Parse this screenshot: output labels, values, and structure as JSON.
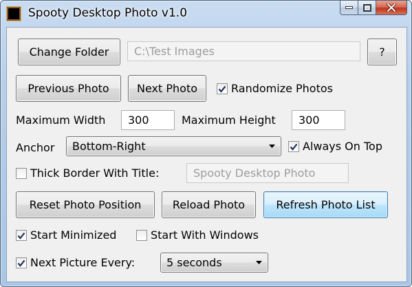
{
  "window": {
    "title": "Spooty Desktop Photo v1.0"
  },
  "icons": {
    "app": "app-photo-icon",
    "minimize": "minimize-icon",
    "maximize": "maximize-icon",
    "close": "close-icon",
    "checkmark": "checkmark-icon",
    "dropdown": "chevron-down-icon"
  },
  "folder": {
    "change_label": "Change Folder",
    "path_value": "C:\\Test Images",
    "help_label": "?"
  },
  "nav": {
    "previous_label": "Previous Photo",
    "next_label": "Next Photo",
    "randomize": {
      "label": "Randomize Photos",
      "checked": true
    }
  },
  "size": {
    "max_width_label": "Maximum Width",
    "max_width_value": "300",
    "max_height_label": "Maximum Height",
    "max_height_value": "300"
  },
  "anchor": {
    "label": "Anchor",
    "selected": "Bottom-Right",
    "always_on_top": {
      "label": "Always On Top",
      "checked": true
    }
  },
  "border": {
    "label": "Thick Border With Title:",
    "checked": false,
    "title_value": "Spooty Desktop Photo"
  },
  "actions": {
    "reset_label": "Reset Photo Position",
    "reload_label": "Reload Photo",
    "refresh_label": "Refresh Photo List"
  },
  "startup": {
    "start_minimized": {
      "label": "Start Minimized",
      "checked": true
    },
    "start_with_windows": {
      "label": "Start With Windows",
      "checked": false
    }
  },
  "interval": {
    "label": "Next Picture Every:",
    "checked": true,
    "selected": "5 seconds"
  },
  "colors": {
    "title_bar": "#b6cfe9",
    "client_bg": "#f0f0f0",
    "close_button": "#c0341c",
    "focused_button": "#bee6fd"
  }
}
